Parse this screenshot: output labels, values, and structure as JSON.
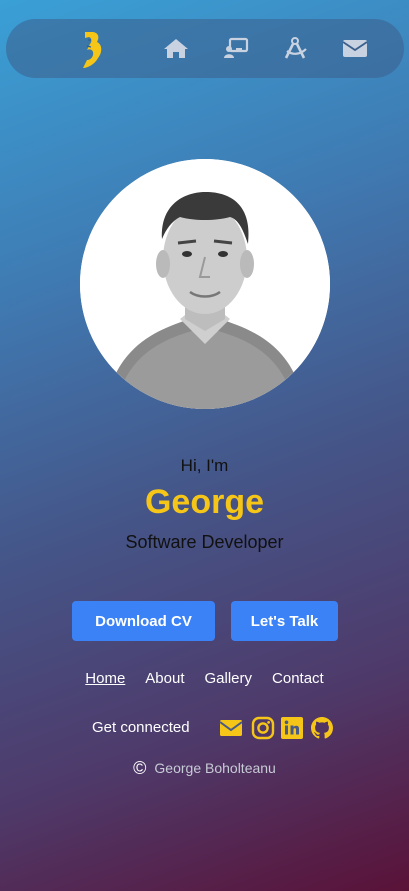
{
  "nav": {
    "logo": "logo-b-icon",
    "icons": [
      "home-icon",
      "presentation-icon",
      "compass-tools-icon",
      "mail-icon"
    ],
    "accent": "#f5c518"
  },
  "profile": {
    "greeting": "Hi, I'm",
    "name": "George",
    "role": "Software Developer"
  },
  "buttons": {
    "download_cv": "Download CV",
    "lets_talk": "Let's Talk",
    "color": "#3b82f6"
  },
  "footer": {
    "links": [
      {
        "label": "Home",
        "active": true
      },
      {
        "label": "About",
        "active": false
      },
      {
        "label": "Gallery",
        "active": false
      },
      {
        "label": "Contact",
        "active": false
      }
    ],
    "connected_label": "Get connected",
    "social": [
      "mail-icon",
      "instagram-icon",
      "linkedin-icon",
      "github-icon"
    ],
    "copyright_symbol": "©",
    "copyright_name": "George Boholteanu"
  }
}
